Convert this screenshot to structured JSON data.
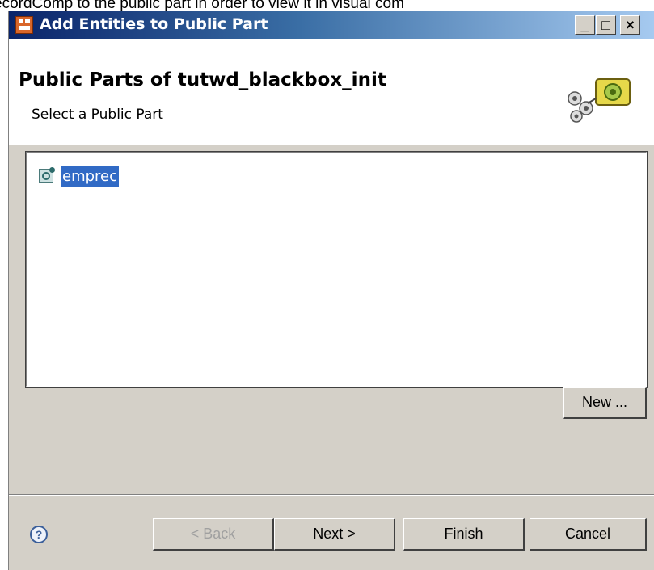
{
  "page_caption": "ecordComp to the public part in order to view it in visual com",
  "window": {
    "title": "Add Entities to Public Part",
    "controls": {
      "minimize": "_",
      "maximize": "□",
      "close": "×"
    }
  },
  "header": {
    "title": "Public Parts of tutwd_blackbox_init",
    "subtitle": "Select a Public Part"
  },
  "public_parts": {
    "items": [
      {
        "label": "emprec",
        "selected": true,
        "icon": "public-part-icon"
      }
    ]
  },
  "buttons": {
    "new": "New ...",
    "back": "< Back",
    "next": "Next >",
    "finish": "Finish",
    "cancel": "Cancel",
    "help": "?"
  },
  "colors": {
    "selection": "#316ac5",
    "dialog_bg": "#d4d0c8",
    "title_gradient_start": "#0a246a"
  }
}
